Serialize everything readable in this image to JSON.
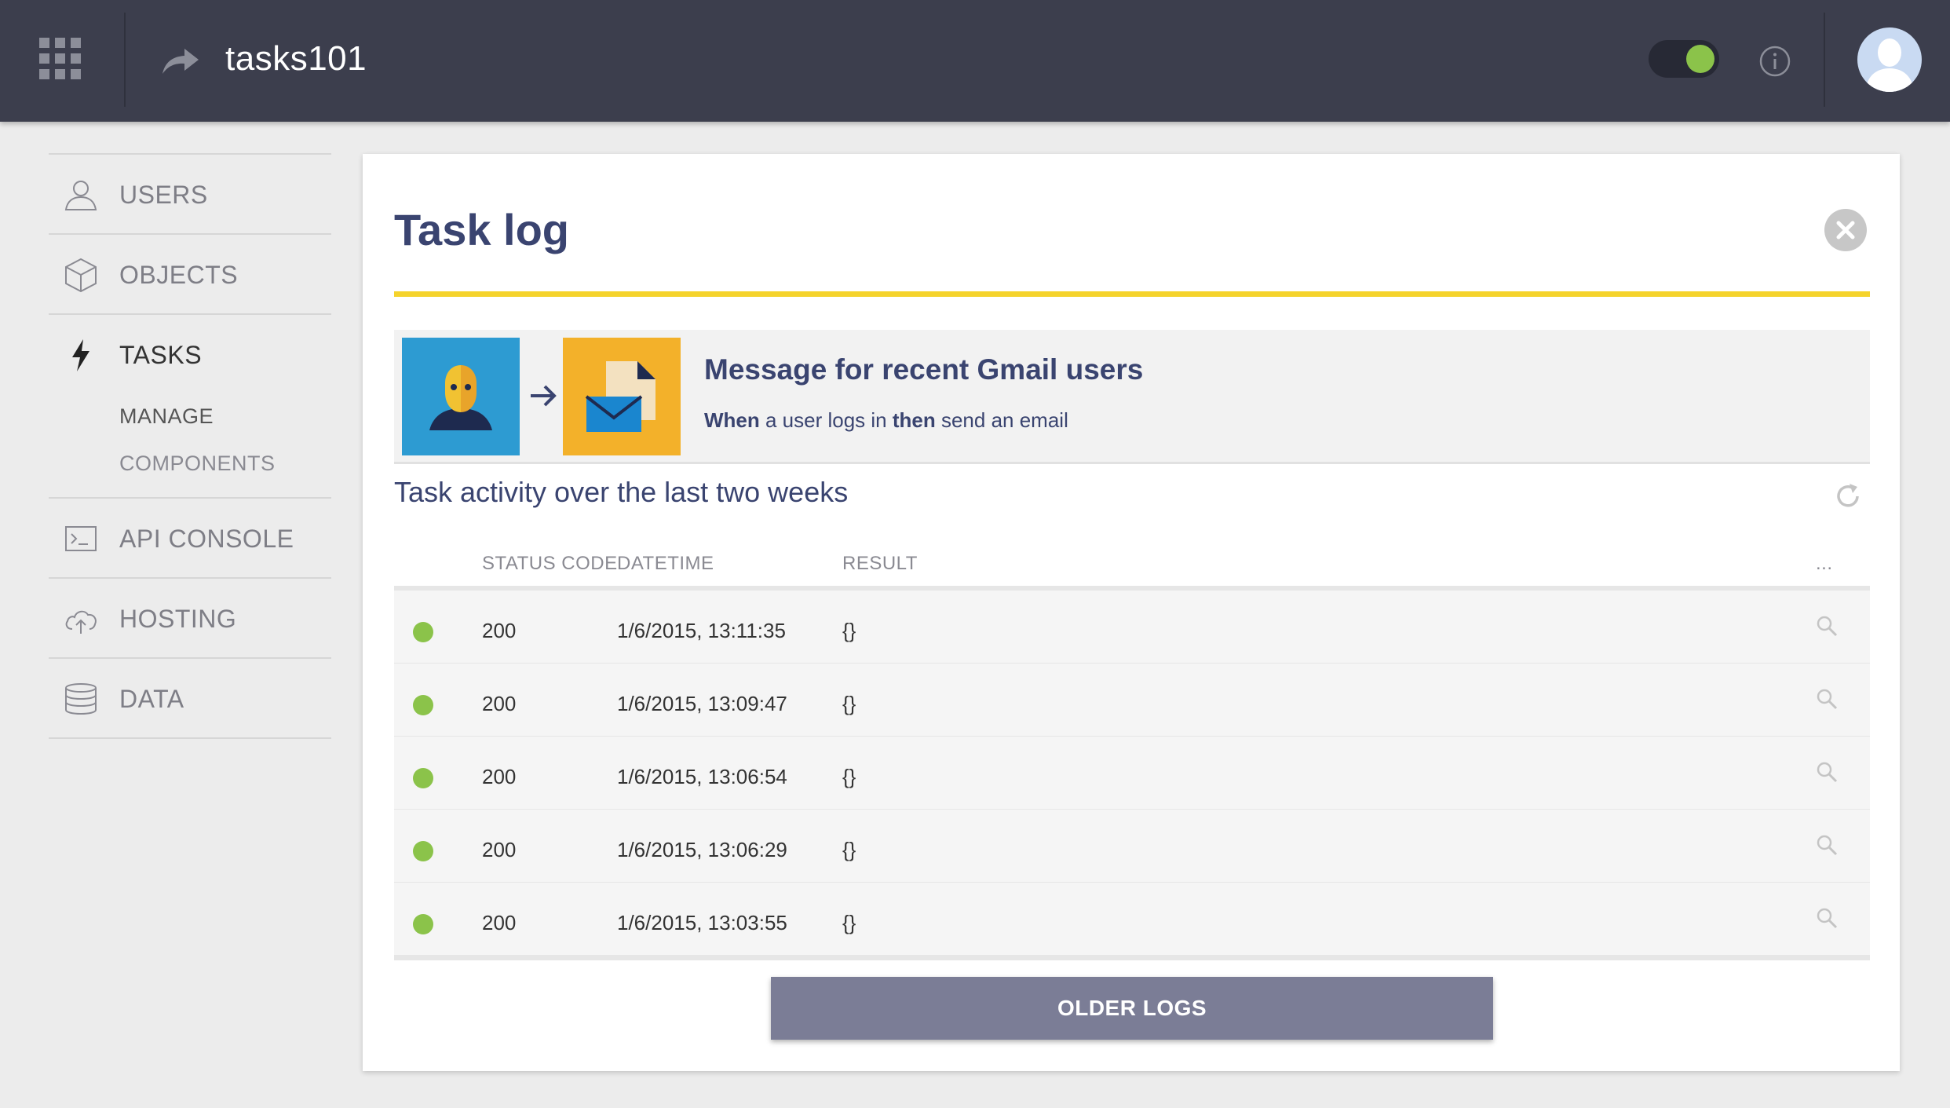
{
  "header": {
    "app_name": "tasks101",
    "toggle_on": true,
    "colors": {
      "bar": "#3c3e4d",
      "toggle_knob": "#8bc34a"
    },
    "icons": [
      "apps-grid-icon",
      "share-arrow-icon",
      "info-icon",
      "user-avatar-icon"
    ]
  },
  "sidebar": {
    "items": [
      {
        "label": "USERS",
        "icon": "user-icon"
      },
      {
        "label": "OBJECTS",
        "icon": "cube-icon"
      },
      {
        "label": "TASKS",
        "icon": "lightning-icon",
        "active": true,
        "subitems": [
          {
            "label": "MANAGE"
          },
          {
            "label": "COMPONENTS"
          }
        ]
      },
      {
        "label": "API CONSOLE",
        "icon": "terminal-icon"
      },
      {
        "label": "HOSTING",
        "icon": "cloud-upload-icon"
      },
      {
        "label": "DATA",
        "icon": "database-icon"
      }
    ]
  },
  "main": {
    "title": "Task log",
    "task": {
      "name": "Message for recent Gmail users",
      "desc_when": "When",
      "desc_mid": " a user logs in ",
      "desc_then": "then",
      "desc_end": " send an email"
    },
    "activity_title": "Task activity over the last two weeks",
    "table": {
      "columns": [
        "STATUS CODE",
        "DATETIME",
        "RESULT",
        "..."
      ],
      "rows": [
        {
          "status": "200",
          "datetime": "1/6/2015, 13:11:35",
          "result": "{}"
        },
        {
          "status": "200",
          "datetime": "1/6/2015, 13:09:47",
          "result": "{}"
        },
        {
          "status": "200",
          "datetime": "1/6/2015, 13:06:54",
          "result": "{}"
        },
        {
          "status": "200",
          "datetime": "1/6/2015, 13:06:29",
          "result": "{}"
        },
        {
          "status": "200",
          "datetime": "1/6/2015, 13:03:55",
          "result": "{}"
        }
      ]
    },
    "older_logs_label": "OLDER LOGS",
    "colors": {
      "accent": "#f5d32c",
      "heading": "#3a4470",
      "success": "#8bc34a",
      "button": "#7b7d96"
    }
  }
}
